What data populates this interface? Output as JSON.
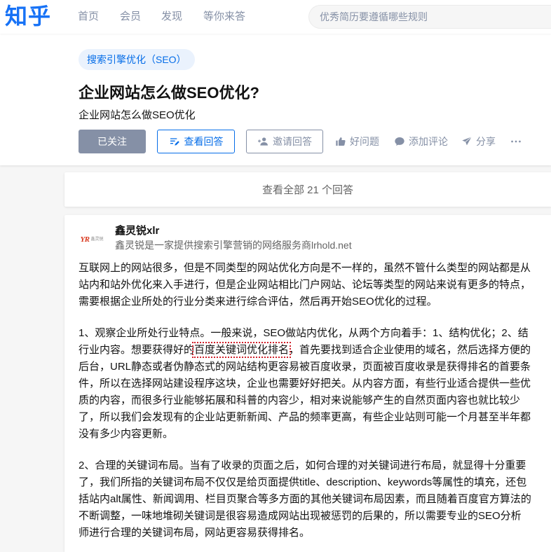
{
  "header": {
    "logo": "知乎",
    "nav": [
      {
        "label": "首页"
      },
      {
        "label": "会员"
      },
      {
        "label": "发现"
      },
      {
        "label": "等你来答"
      }
    ],
    "search": {
      "placeholder": "优秀简历要遵循哪些规则"
    }
  },
  "question": {
    "topic": "搜索引擎优化（SEO）",
    "title": "企业网站怎么做SEO优化?",
    "detail": "企业网站怎么做SEO优化",
    "actions": {
      "follow_label": "已关注",
      "view_answers_label": "查看回答",
      "invite_label": "邀请回答",
      "good_question_label": "好问题",
      "comment_label": "添加评论",
      "share_label": "分享"
    }
  },
  "view_all": {
    "label": "查看全部 21 个回答"
  },
  "answer": {
    "author": {
      "avatar_mark": "YR",
      "avatar_caption": "鑫灵锐",
      "name": "鑫灵锐xlr",
      "bio": "鑫灵锐是一家提供搜索引擎营销的网络服务商lrhold.net"
    },
    "paragraphs": [
      {
        "text": "互联网上的网站很多，但是不同类型的网站优化方向是不一样的，虽然不管什么类型的网站都是从站内和站外优化来入手进行，但是企业网站相比门户网站、论坛等类型的网站来说有更多的特点，需要根据企业所处的行业分类来进行综合评估，然后再开始SEO优化的过程。"
      },
      {
        "before": "1、观察企业所处行业特点。一般来说，SEO做站内优化，从两个方向着手：1、结构优化；2、结行业内容。想要获得好的",
        "highlight": "百度关键词优化排名",
        "after": "，首先要找到适合企业使用的域名，然后选择方便的后台，URL静态或者伪静态式的网站结构更容易被百度收录，页面被百度收录是获得排名的首要条件，所以在选择网站建设程序这块，企业也需要好好把关。从内容方面，有些行业适合提供一些优质的内容，而很多行业能够拓展和科普的内容少，相对来说能够产生的自然页面内容也就比较少了，所以我们会发现有的企业站更新新闻、产品的频率更高，有些企业站则可能一个月甚至半年都没有多少内容更新。"
      },
      {
        "text": "2、合理的关键词布局。当有了收录的页面之后，如何合理的对关键词进行布局，就显得十分重要了，我们所指的关键词布局不仅仅是给页面提供title、description、keywords等属性的填充，还包括站内alt属性、新闻调用、栏目页聚合等多方面的其他关键词布局因素，而且随着百度官方算法的不断调整，一味地堆砌关键词是很容易造成网站出现被惩罚的后果的，所以需要专业的SEO分析师进行合理的关键词布局，网站更容易获得排名。"
      }
    ]
  },
  "icons": {
    "view_answers": "edit-lines-icon",
    "invite": "invite-user-icon",
    "good_question": "thumbs-up-icon",
    "comment": "comment-icon",
    "share": "paper-plane-icon",
    "more": "more-icon"
  },
  "colors": {
    "brand": "#1772f6",
    "link": "#056de8",
    "muted": "#8590a6",
    "text": "#121212",
    "secondary_text": "#646464",
    "page_bg": "#f6f6f6",
    "tag_bg": "#eaf2fd",
    "highlight": "#d0202a"
  }
}
